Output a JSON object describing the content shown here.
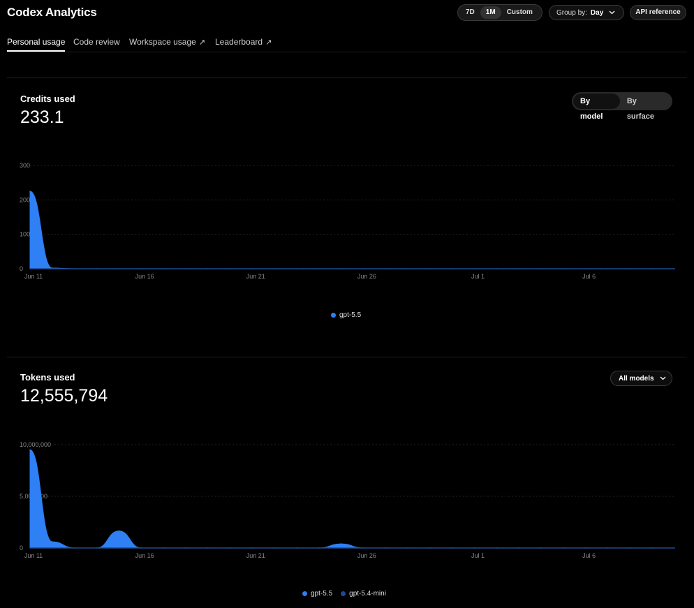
{
  "app": {
    "title": "Codex Analytics"
  },
  "range": {
    "options": [
      "7D",
      "1M",
      "Custom"
    ],
    "active": "1M"
  },
  "group_by": {
    "label": "Group by:",
    "value": "Day"
  },
  "api_reference": "API reference",
  "tabs": [
    {
      "label": "Personal usage",
      "external": false,
      "active": true
    },
    {
      "label": "Code review",
      "external": false,
      "active": false
    },
    {
      "label": "Workspace usage",
      "external": true,
      "active": false
    },
    {
      "label": "Leaderboard",
      "external": true,
      "active": false
    }
  ],
  "credits": {
    "title": "Credits used",
    "value": "233.1",
    "toggle": {
      "options": [
        "By model",
        "By surface"
      ],
      "active": "By model"
    }
  },
  "tokens": {
    "title": "Tokens used",
    "value": "12,555,794",
    "filter": "All models"
  },
  "colors": {
    "gpt55": "#2f7ff5",
    "gpt54mini": "#1e4b8f",
    "bg": "#000000"
  },
  "chart_data": [
    {
      "type": "area",
      "title": "Credits used",
      "x": [
        "Jun 11",
        "Jun 12",
        "Jun 13",
        "Jun 14",
        "Jun 15",
        "Jun 16",
        "Jun 17",
        "Jun 18",
        "Jun 19",
        "Jun 20",
        "Jun 21",
        "Jun 22",
        "Jun 23",
        "Jun 24",
        "Jun 25",
        "Jun 26",
        "Jun 27",
        "Jun 28",
        "Jun 29",
        "Jun 30",
        "Jul 1",
        "Jul 2",
        "Jul 3",
        "Jul 4",
        "Jul 5",
        "Jul 6",
        "Jul 7",
        "Jul 8",
        "Jul 9",
        "Jul 10"
      ],
      "x_tick_labels": [
        "Jun 11",
        "Jun 16",
        "Jun 21",
        "Jun 26",
        "Jul 1",
        "Jul 6"
      ],
      "y_tick_labels": [
        "0",
        "100",
        "200",
        "300"
      ],
      "ylim": [
        0,
        300
      ],
      "series": [
        {
          "name": "gpt-5.5",
          "values": [
            225,
            2,
            0,
            0,
            0,
            0,
            0,
            0,
            0,
            0,
            0,
            0,
            0,
            0,
            0,
            0,
            0,
            0,
            0,
            0,
            0,
            0,
            0,
            0,
            0,
            0,
            0,
            0,
            0,
            0
          ]
        }
      ],
      "legend": [
        "gpt-5.5"
      ],
      "grid": true
    },
    {
      "type": "area",
      "title": "Tokens used",
      "x": [
        "Jun 11",
        "Jun 12",
        "Jun 13",
        "Jun 14",
        "Jun 15",
        "Jun 16",
        "Jun 17",
        "Jun 18",
        "Jun 19",
        "Jun 20",
        "Jun 21",
        "Jun 22",
        "Jun 23",
        "Jun 24",
        "Jun 25",
        "Jun 26",
        "Jun 27",
        "Jun 28",
        "Jun 29",
        "Jun 30",
        "Jul 1",
        "Jul 2",
        "Jul 3",
        "Jul 4",
        "Jul 5",
        "Jul 6",
        "Jul 7",
        "Jul 8",
        "Jul 9",
        "Jul 10"
      ],
      "x_tick_labels": [
        "Jun 11",
        "Jun 16",
        "Jun 21",
        "Jun 26",
        "Jul 1",
        "Jul 6"
      ],
      "y_tick_labels": [
        "0",
        "5,000,000",
        "10,000,000"
      ],
      "ylim": [
        0,
        10000000
      ],
      "series": [
        {
          "name": "gpt-5.5",
          "values": [
            9500000,
            600000,
            0,
            0,
            1650000,
            0,
            0,
            0,
            0,
            0,
            0,
            0,
            0,
            0,
            400000,
            0,
            0,
            0,
            0,
            0,
            0,
            0,
            0,
            0,
            0,
            0,
            0,
            0,
            0,
            0
          ]
        },
        {
          "name": "gpt-5.4-mini",
          "values": [
            0,
            0,
            0,
            0,
            0,
            0,
            0,
            0,
            0,
            0,
            0,
            0,
            0,
            0,
            0,
            0,
            0,
            0,
            0,
            0,
            0,
            0,
            0,
            0,
            0,
            0,
            0,
            0,
            0,
            0
          ]
        }
      ],
      "legend": [
        "gpt-5.5",
        "gpt-5.4-mini"
      ],
      "grid": true
    }
  ]
}
